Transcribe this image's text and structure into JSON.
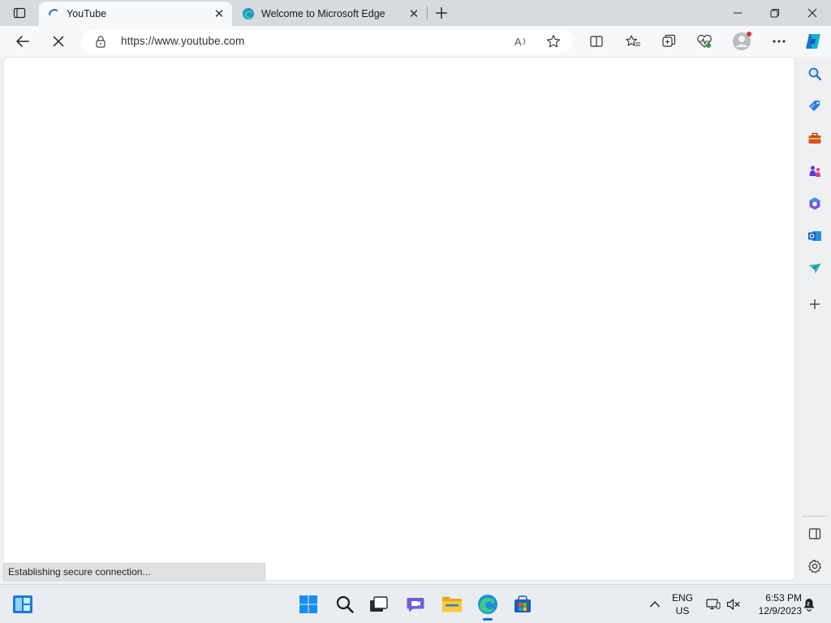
{
  "browser": {
    "tabs": [
      {
        "title": "YouTube",
        "active": true,
        "icon": "loading-spinner-icon"
      },
      {
        "title": "Welcome to Microsoft Edge",
        "active": false,
        "icon": "edge-logo-icon"
      }
    ],
    "address": {
      "url": "https://www.youtube.com"
    },
    "status_text": "Establishing secure connection..."
  },
  "taskbar": {
    "language": {
      "line1": "ENG",
      "line2": "US"
    },
    "clock": {
      "time": "6:53 PM",
      "date": "12/9/2023"
    }
  },
  "colors": {
    "accent": "#0a6ed1",
    "tab_strip": "#d6dbe0",
    "toolbar": "#f7f8f9",
    "taskbar": "#e9edf1"
  }
}
